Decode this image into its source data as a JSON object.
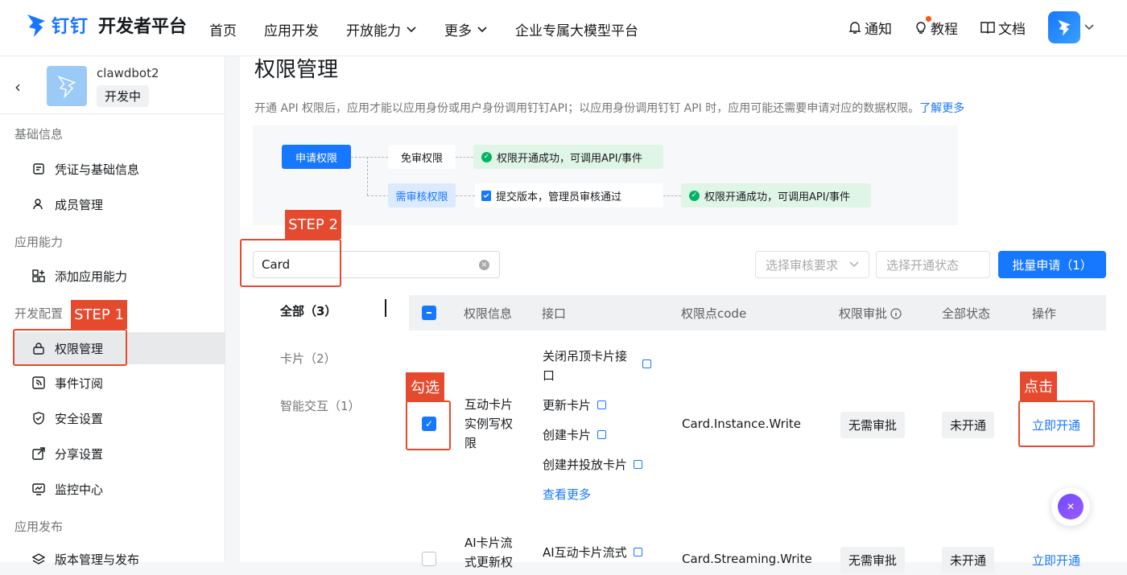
{
  "header": {
    "logo_brand": "钉钉",
    "logo_title": "开发者平台",
    "nav": [
      {
        "label": "首页"
      },
      {
        "label": "应用开发"
      },
      {
        "label": "开放能力"
      },
      {
        "label": "更多"
      },
      {
        "label": "企业专属大模型平台"
      }
    ],
    "notify_label": "通知",
    "tutorial_label": "教程",
    "docs_label": "文档"
  },
  "sidebar": {
    "app_name": "clawdbot2",
    "app_status": "开发中",
    "groups": {
      "basic": "基础信息",
      "ability": "应用能力",
      "dev": "开发配置",
      "publish": "应用发布"
    },
    "items": [
      {
        "label": "凭证与基础信息"
      },
      {
        "label": "成员管理"
      },
      {
        "label": "添加应用能力"
      },
      {
        "label": "权限管理"
      },
      {
        "label": "事件订阅"
      },
      {
        "label": "安全设置"
      },
      {
        "label": "分享设置"
      },
      {
        "label": "监控中心"
      },
      {
        "label": "版本管理与发布"
      }
    ]
  },
  "main": {
    "title": "权限管理",
    "desc": "开通 API 权限后，应用才能以应用身份或用户身份调用钉钉API；以应用身份调用钉钉 API 时，应用可能还需要申请对应的数据权限。",
    "learn_more": "了解更多",
    "flow": {
      "apply": "申请权限",
      "no_review": "免审权限",
      "success1": "权限开通成功，可调用API/事件",
      "need_review": "需审核权限",
      "submit": "提交版本，管理员审核通过",
      "success2": "权限开通成功，可调用API/事件"
    },
    "search_value": "Card",
    "select_review_placeholder": "选择审核要求",
    "select_status_placeholder": "选择开通状态",
    "batch_button": "批量申请（1）",
    "categories": [
      {
        "label": "全部（3）"
      },
      {
        "label": "卡片（2）"
      },
      {
        "label": "智能交互（1）"
      }
    ],
    "table": {
      "headers": {
        "info": "权限信息",
        "api": "接口",
        "code": "权限点code",
        "approval": "权限审批",
        "status": "全部状态",
        "action": "操作"
      },
      "rows": [
        {
          "info": [
            "互动卡片",
            "实例写权",
            "限"
          ],
          "apis": [
            "关闭吊顶卡片接",
            "口",
            "更新卡片",
            "创建卡片",
            "创建并投放卡片"
          ],
          "more": "查看更多",
          "code": "Card.Instance.Write",
          "approval": "无需审批",
          "status": "未开通",
          "action": "立即开通"
        },
        {
          "info": [
            "AI卡片流",
            "式更新权"
          ],
          "apis": [
            "AI互动卡片流式"
          ],
          "code": "Card.Streaming.Write",
          "approval": "无需审批",
          "status": "未开通",
          "action": "立即开通"
        }
      ]
    }
  },
  "annotations": {
    "step1": "STEP 1",
    "step2": "STEP 2",
    "check": "勾选",
    "click": "点击"
  },
  "colors": {
    "primary": "#1677ff",
    "annotation": "#e54a2e",
    "success": "#00b365"
  }
}
